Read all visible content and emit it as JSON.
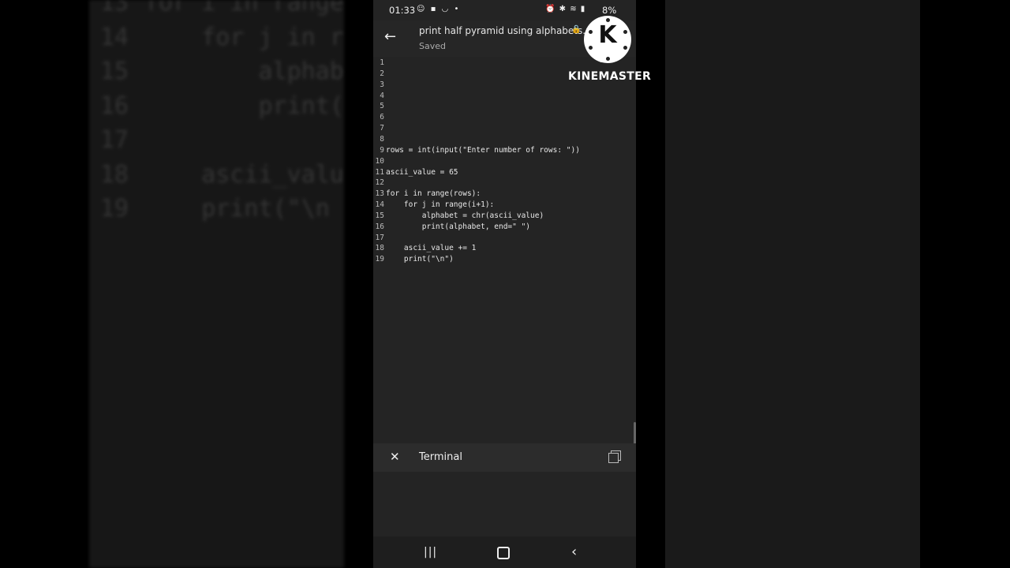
{
  "status": {
    "time": "01:33",
    "battery": "8%"
  },
  "appbar": {
    "file_title": "print half pyramid using alphabets.py",
    "status": "Saved"
  },
  "watermark": {
    "brand": "KINEMASTER",
    "logo_letter": "K"
  },
  "code": {
    "lines": [
      {
        "n": "1",
        "text": ""
      },
      {
        "n": "2",
        "text": ""
      },
      {
        "n": "3",
        "text": ""
      },
      {
        "n": "4",
        "text": ""
      },
      {
        "n": "5",
        "text": ""
      },
      {
        "n": "6",
        "text": ""
      },
      {
        "n": "7",
        "text": ""
      },
      {
        "n": "8",
        "text": ""
      },
      {
        "n": "9",
        "text": "rows = int(input(\"Enter number of rows: \"))"
      },
      {
        "n": "10",
        "text": ""
      },
      {
        "n": "11",
        "text": "ascii_value = 65"
      },
      {
        "n": "12",
        "text": ""
      },
      {
        "n": "13",
        "text": "for i in range(rows):"
      },
      {
        "n": "14",
        "text": "    for j in range(i+1):"
      },
      {
        "n": "15",
        "text": "        alphabet = chr(ascii_value)"
      },
      {
        "n": "16",
        "text": "        print(alphabet, end=\" \")"
      },
      {
        "n": "17",
        "text": ""
      },
      {
        "n": "18",
        "text": "    ascii_value += 1"
      },
      {
        "n": "19",
        "text": "    print(\"\\n\")"
      }
    ]
  },
  "background_code": [
    {
      "n": "13",
      "text": "for i in range"
    },
    {
      "n": "14",
      "text": "    for j in r"
    },
    {
      "n": "15",
      "text": "        alphab"
    },
    {
      "n": "16",
      "text": "        print("
    },
    {
      "n": "17",
      "text": ""
    },
    {
      "n": "18",
      "text": "    ascii_valu"
    },
    {
      "n": "19",
      "text": "    print(\"\\n"
    }
  ],
  "terminal": {
    "title": "Terminal"
  },
  "icons": {
    "back": "arrow-left-icon",
    "lock": "lock-icon",
    "close": "close-icon",
    "copy": "copy-icon",
    "nav_recent": "recent-apps-icon",
    "nav_home": "home-icon",
    "nav_back": "chevron-left-icon"
  }
}
